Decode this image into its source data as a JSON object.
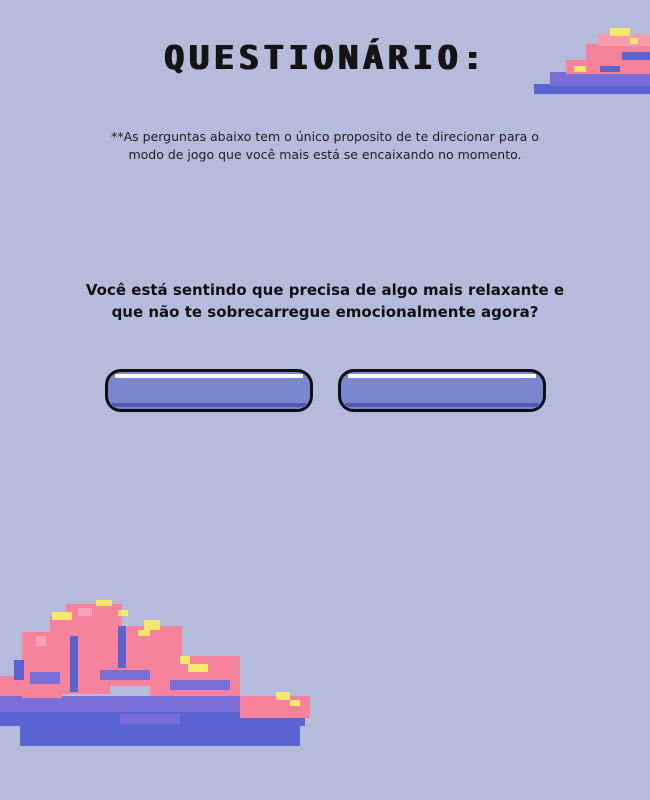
{
  "page": {
    "title": "QUESTIONÁRIO:",
    "subtitle": "**As perguntas abaixo tem o único proposito de te direcionar para o modo de jogo que você mais está se encaixando no momento."
  },
  "question": {
    "text": "Você está sentindo que precisa de algo mais relaxante e que não te sobrecarregue emocionalmente agora?"
  },
  "answers": [
    {
      "label": ""
    },
    {
      "label": ""
    }
  ],
  "colors": {
    "background": "#b5bcdb",
    "button_fill": "#7a86cd",
    "cloud_pink": "#f7829b",
    "cloud_purple": "#5a63d2",
    "cloud_yellow": "#f5e86a"
  },
  "decorations": {
    "top_cloud": "pixel-cloud-icon",
    "bottom_cloud": "pixel-cloud-icon"
  }
}
